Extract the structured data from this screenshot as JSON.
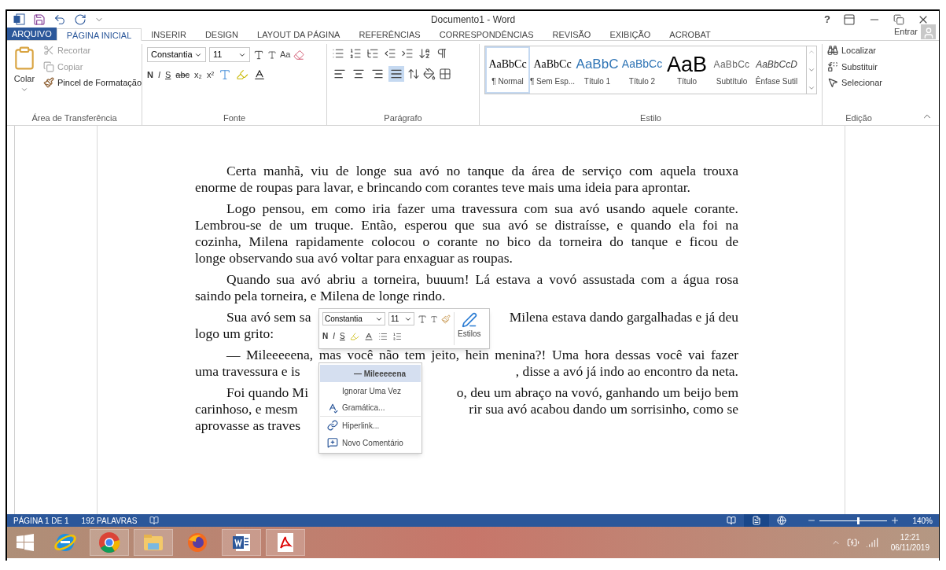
{
  "window": {
    "title": "Documento1 - Word",
    "help": "?"
  },
  "tabs": [
    {
      "label": "ARQUIVO",
      "kind": "file",
      "selected": false
    },
    {
      "label": "PÁGINA INICIAL",
      "kind": "tab",
      "selected": true
    },
    {
      "label": "INSERIR",
      "kind": "tab",
      "selected": false
    },
    {
      "label": "DESIGN",
      "kind": "tab",
      "selected": false
    },
    {
      "label": "LAYOUT DA PÁGINA",
      "kind": "tab",
      "selected": false
    },
    {
      "label": "REFERÊNCIAS",
      "kind": "tab",
      "selected": false
    },
    {
      "label": "CORRESPONDÊNCIAS",
      "kind": "tab",
      "selected": false
    },
    {
      "label": "REVISÃO",
      "kind": "tab",
      "selected": false
    },
    {
      "label": "EXIBIÇÃO",
      "kind": "tab",
      "selected": false
    },
    {
      "label": "ACROBAT",
      "kind": "tab",
      "selected": false
    }
  ],
  "account": {
    "label": "Entrar"
  },
  "clipboard": {
    "label": "Área de Transferência",
    "paste": "Colar",
    "items": [
      {
        "label": "Recortar",
        "kind": "cut",
        "disabled": true
      },
      {
        "label": "Copiar",
        "kind": "copy",
        "disabled": true
      },
      {
        "label": "Pincel de Formatação",
        "kind": "painter",
        "disabled": false
      }
    ]
  },
  "font": {
    "label": "Fonte",
    "name": "Constantia",
    "size": "11",
    "case_button": "Aa",
    "format_buttons": [
      "N",
      "I",
      "S",
      "abc",
      "x₂",
      "x²"
    ]
  },
  "paragraph": {
    "label": "Parágrafo",
    "alignments": [
      {
        "kind": "left",
        "selected": false
      },
      {
        "kind": "center",
        "selected": false
      },
      {
        "kind": "right",
        "selected": false
      },
      {
        "kind": "justify",
        "selected": true
      }
    ]
  },
  "styles": {
    "label": "Estilo",
    "items": [
      {
        "preview": "AaBbCc",
        "name": "¶ Normal",
        "kind": "normal",
        "selected": true
      },
      {
        "preview": "AaBbCc",
        "name": "¶ Sem Esp...",
        "kind": "normal",
        "selected": false
      },
      {
        "preview": "AaBbC",
        "name": "Título 1",
        "kind": "heading1",
        "selected": false
      },
      {
        "preview": "AaBbCc",
        "name": "Título 2",
        "kind": "heading2",
        "selected": false
      },
      {
        "preview": "AaB",
        "name": "Título",
        "kind": "title",
        "selected": false
      },
      {
        "preview": "AaBbCc",
        "name": "Subtítulo",
        "kind": "subtitle",
        "selected": false
      },
      {
        "preview": "AaBbCcD",
        "name": "Ênfase Sutil",
        "kind": "emphasis",
        "selected": false
      }
    ]
  },
  "editing": {
    "label": "Edição",
    "items": [
      {
        "label": "Localizar",
        "kind": "find"
      },
      {
        "label": "Substituir",
        "kind": "replace"
      },
      {
        "label": "Selecionar",
        "kind": "select"
      }
    ]
  },
  "document": {
    "paragraphs": [
      {
        "lines": [
          {
            "left": "Certa manhã, viu de longe sua avó no tanque da área de serviço com aquela trouxa"
          },
          {
            "left": "enorme de roupas para lavar, e brincando com corantes teve mais uma ideia para aprontar."
          }
        ]
      },
      {
        "lines": [
          {
            "left": "Logo pensou, em como iria fazer uma travessura com sua avó usando aquele corante."
          },
          {
            "left": "Lembrou-se de um truque. Então, esperou que sua avó se distraísse, e quando ela foi na"
          },
          {
            "left": "cozinha, Milena rapidamente colocou o corante no bico da torneira do tanque e ficou de"
          },
          {
            "left": "longe observando sua avó voltar para enxaguar as roupas."
          }
        ]
      },
      {
        "lines": [
          {
            "left": "Quando sua avó abriu a torneira, buuum!  Lá estava a vovó assustada com a água rosa"
          },
          {
            "left": "saindo pela torneira, e Milena de longe rindo."
          }
        ]
      },
      {
        "lines": [
          {
            "left": "Sua avó sem sa",
            "right": "Milena estava dando gargalhadas e já deu"
          },
          {
            "left": "logo um grito:"
          }
        ]
      },
      {
        "lines": [
          {
            "left": "— Mileeeeena, mas você não tem jeito, hein menina?! Uma hora dessas você vai fazer"
          },
          {
            "left": "uma travessura e is",
            "right": ", disse a avó já indo ao encontro da neta."
          }
        ]
      },
      {
        "lines": [
          {
            "left": "Foi quando Mi",
            "right": "o, deu um abraço na vovó, ganhando um beijo bem"
          },
          {
            "left": "carinhoso, e mesm",
            "right": "rir sua avó acabou dando um sorrisinho, como se"
          },
          {
            "left": "aprovasse as traves"
          }
        ]
      }
    ]
  },
  "mini_toolbar": {
    "font": "Constantia",
    "size": "11",
    "format_buttons": [
      "N",
      "I",
      "S"
    ],
    "styles": "Estilos"
  },
  "context_menu": [
    {
      "label": "— Mileeeeena",
      "kind": "suggestion",
      "selected": true
    },
    {
      "label": "Ignorar Uma Vez",
      "kind": "ignore",
      "selected": false
    },
    {
      "label": "Gramática...",
      "kind": "grammar",
      "selected": false
    },
    {
      "label": "Hiperlink...",
      "kind": "link",
      "selected": false
    },
    {
      "label": "Novo Comentário",
      "kind": "comment",
      "selected": false
    }
  ],
  "status_bar": {
    "page": "PÁGINA 1 DE 1",
    "words": "192 PALAVRAS",
    "views": [
      {
        "kind": "read",
        "selected": false
      },
      {
        "kind": "print",
        "selected": true
      },
      {
        "kind": "web",
        "selected": false
      }
    ],
    "zoom": {
      "level": 0.55,
      "reading": "140%"
    }
  },
  "taskbar": {
    "apps": [
      {
        "kind": "ie",
        "open": false
      },
      {
        "kind": "chrome",
        "open": true
      },
      {
        "kind": "explorer",
        "open": true
      },
      {
        "kind": "firefox",
        "open": false
      },
      {
        "kind": "word",
        "open": true
      },
      {
        "kind": "pdf",
        "open": true
      }
    ],
    "time": "12:21",
    "date": "06/11/2019"
  }
}
